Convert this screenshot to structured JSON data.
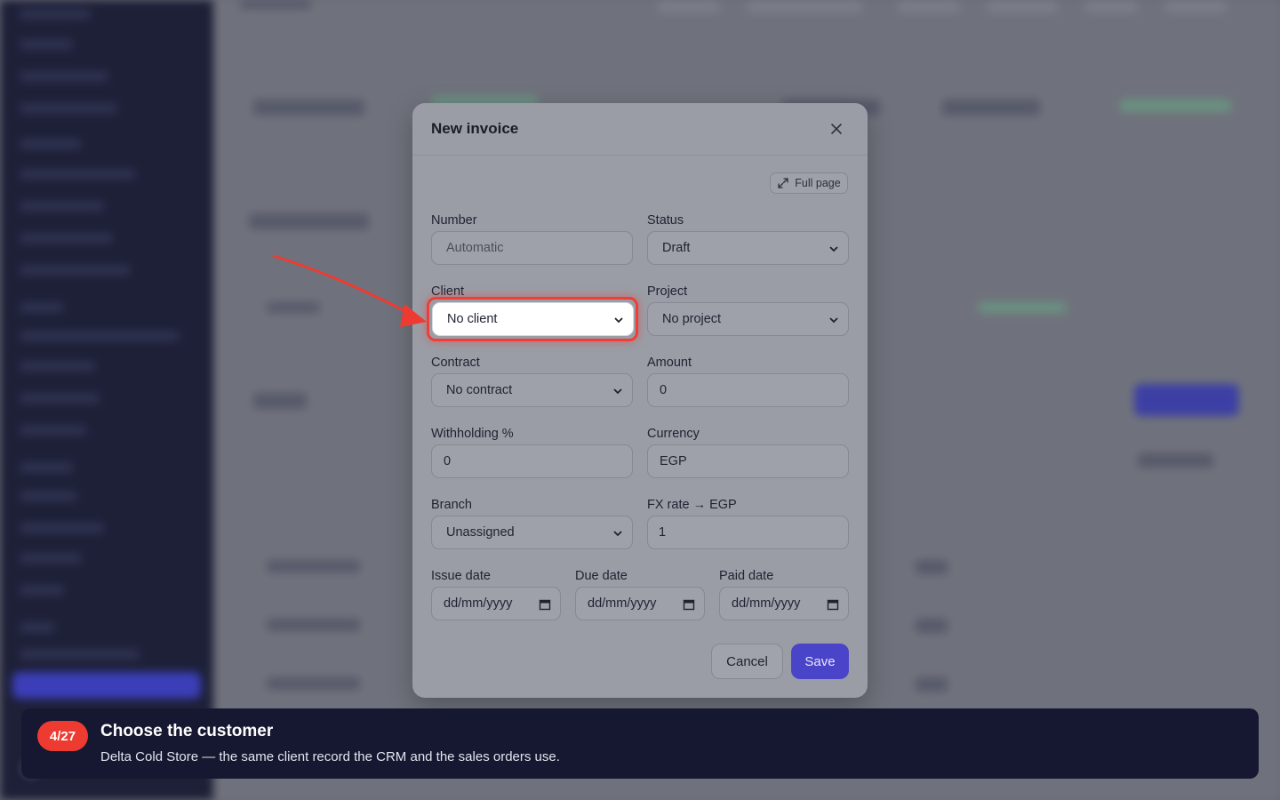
{
  "modal": {
    "title": "New invoice",
    "fullpage_label": "Full page",
    "fields": {
      "number": {
        "label": "Number",
        "placeholder": "Automatic"
      },
      "status": {
        "label": "Status",
        "value": "Draft"
      },
      "client": {
        "label": "Client",
        "value": "No client"
      },
      "project": {
        "label": "Project",
        "value": "No project"
      },
      "contract": {
        "label": "Contract",
        "value": "No contract"
      },
      "amount": {
        "label": "Amount",
        "value": "0"
      },
      "withholding": {
        "label": "Withholding %",
        "value": "0"
      },
      "currency": {
        "label": "Currency",
        "value": "EGP"
      },
      "branch": {
        "label": "Branch",
        "value": "Unassigned"
      },
      "fx_rate": {
        "label": "FX rate → EGP",
        "value": "1"
      },
      "issue_date": {
        "label": "Issue date",
        "value": "dd/mm/yyyy"
      },
      "due_date": {
        "label": "Due date",
        "value": "dd/mm/yyyy"
      },
      "paid_date": {
        "label": "Paid date",
        "value": "dd/mm/yyyy"
      }
    },
    "cancel_label": "Cancel",
    "save_label": "Save"
  },
  "tour": {
    "step": "4/27",
    "title": "Choose the customer",
    "description": "Delta Cold Store — the same client record the CRM and the sales orders use."
  },
  "colors": {
    "accent": "#4a44c8",
    "highlight": "#ef3e36",
    "tour_background": "#151830"
  },
  "icons": [
    "close-icon",
    "expand-icon",
    "chevron-down-icon",
    "calendar-icon",
    "arrow-pointer"
  ]
}
